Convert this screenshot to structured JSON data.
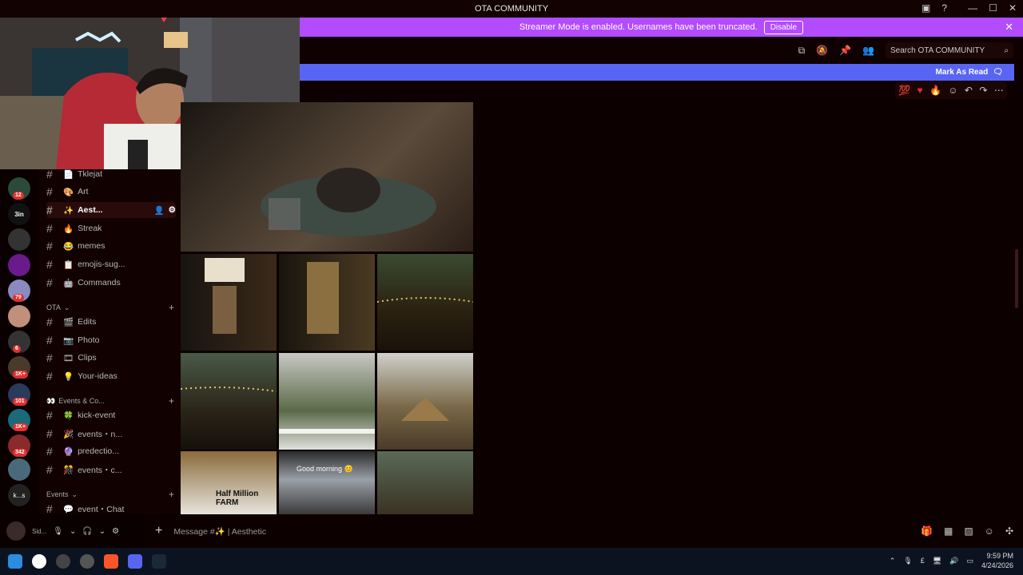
{
  "window": {
    "title": "OTA COMMUNITY"
  },
  "banner": {
    "text": "Streamer Mode is enabled. Usernames have been truncated.",
    "disable_label": "Disable"
  },
  "header": {
    "search_placeholder": "Search OTA COMMUNITY"
  },
  "new_messages": {
    "mark_as_read": "Mark As Read"
  },
  "servers": {
    "badges": [
      "12",
      "79",
      "6",
      "1K+",
      "101",
      "1K+",
      "342"
    ],
    "abbrev": [
      "3in",
      "k...s"
    ]
  },
  "channels": {
    "items": [
      {
        "emoji": "📄",
        "label": "Tklejat"
      },
      {
        "emoji": "🎨",
        "label": "Art"
      },
      {
        "emoji": "✨",
        "label": "Aest..."
      },
      {
        "emoji": "🔥",
        "label": "Streak"
      },
      {
        "emoji": "😂",
        "label": "memes"
      },
      {
        "emoji": "📋",
        "label": "emojis-sug..."
      },
      {
        "emoji": "🤖",
        "label": "Commands"
      }
    ],
    "cat_ota": "OTA",
    "ota_items": [
      {
        "emoji": "🎬",
        "label": "Edits"
      },
      {
        "emoji": "📷",
        "label": "Photo"
      },
      {
        "emoji": "🎞",
        "label": "Clips"
      },
      {
        "emoji": "💡",
        "label": "Your-ideas"
      }
    ],
    "cat_events_co": "Events & Co...",
    "events_co_items": [
      {
        "emoji": "🍀",
        "label": "kick-event"
      },
      {
        "emoji": "🎉",
        "label": "events・n..."
      },
      {
        "emoji": "🔮",
        "label": "predectio..."
      },
      {
        "emoji": "🎊",
        "label": "events・c..."
      }
    ],
    "cat_events": "Events",
    "events_items": [
      {
        "emoji": "💬",
        "label": "event・Chat"
      }
    ]
  },
  "gallery": {
    "caption_good_morning": "Good morning 😊",
    "caption_farm": "Half Million FARM"
  },
  "composer": {
    "placeholder": "Message #✨ | Aesthetic"
  },
  "user": {
    "name": "Sid..."
  },
  "taskbar": {
    "time": "9:59 PM",
    "date": "4/24/2026"
  },
  "colors": {
    "banner": "#b34bff",
    "new_bar": "#5865f2",
    "badge": "#e03030",
    "background": "#0d0000"
  }
}
